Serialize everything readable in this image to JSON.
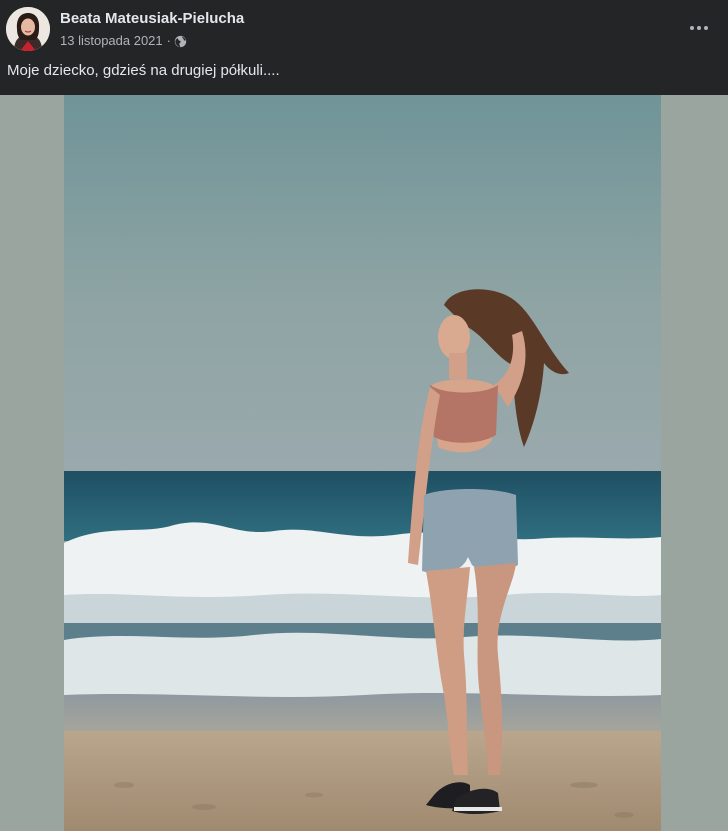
{
  "post": {
    "author_name": "Beata Mateusiak-Pielucha",
    "date": "13 listopada 2021",
    "separator": "·",
    "privacy_icon": "globe-icon",
    "more_icon": "more-options-icon",
    "text": "Moje dziecko, gdzieś na drugiej półkuli...."
  },
  "colors": {
    "background": "#242526",
    "primary_text": "#e4e6eb",
    "secondary_text": "#b0b3b8",
    "photo_backdrop": "#9aa5a0"
  }
}
